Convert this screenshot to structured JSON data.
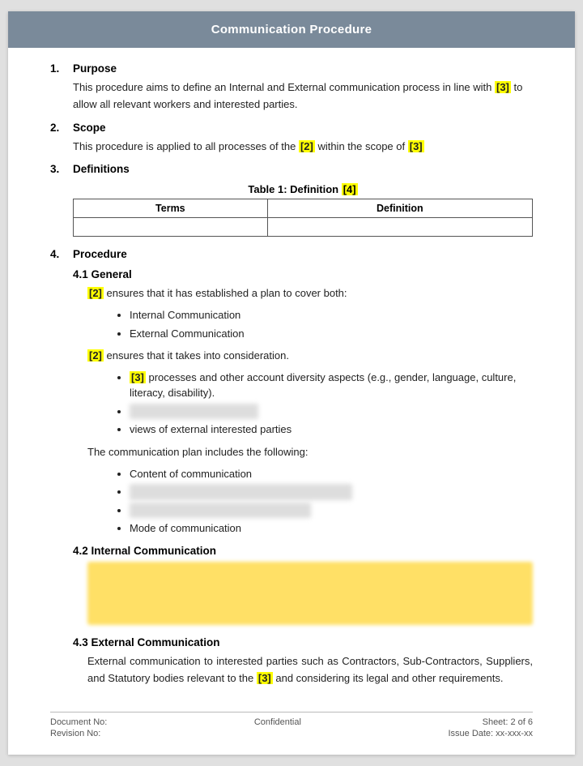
{
  "header": {
    "title": "Communication Procedure"
  },
  "sections": [
    {
      "num": "1.",
      "label": "Purpose",
      "paras": [
        {
          "parts": [
            {
              "type": "text",
              "value": "This procedure aims to define an Internal and External communication process in line with "
            },
            {
              "type": "highlight",
              "value": "[3]"
            },
            {
              "type": "text",
              "value": " to allow all relevant workers and interested parties."
            }
          ]
        }
      ]
    },
    {
      "num": "2.",
      "label": "Scope",
      "paras": [
        {
          "parts": [
            {
              "type": "text",
              "value": "This procedure is applied to all processes of the "
            },
            {
              "type": "highlight",
              "value": "[2]"
            },
            {
              "type": "text",
              "value": " within the scope of "
            },
            {
              "type": "highlight",
              "value": "[3]"
            }
          ]
        }
      ]
    },
    {
      "num": "3.",
      "label": "Definitions",
      "table_caption": "Table 1: Definition ",
      "table_caption_ref": "[4]",
      "table_headers": [
        "Terms",
        "Definition"
      ],
      "table_rows": [
        [
          "",
          ""
        ]
      ]
    },
    {
      "num": "4.",
      "label": "Procedure",
      "subsections": [
        {
          "label": "4.1 General",
          "content": [
            {
              "type": "para_parts",
              "parts": [
                {
                  "type": "highlight",
                  "value": "[2]"
                },
                {
                  "type": "text",
                  "value": " ensures that it has established a plan to cover both:"
                }
              ]
            },
            {
              "type": "bullets",
              "items": [
                "Internal Communication",
                "External Communication"
              ]
            },
            {
              "type": "para_parts",
              "parts": [
                {
                  "type": "highlight",
                  "value": "[2]"
                },
                {
                  "type": "text",
                  "value": " ensures that it takes into consideration."
                }
              ]
            },
            {
              "type": "bullets_mixed",
              "items": [
                {
                  "type": "parts",
                  "parts": [
                    {
                      "type": "highlight",
                      "value": "[3]"
                    },
                    {
                      "type": "text",
                      "value": " processes and other account diversity aspects (e.g., gender, language, culture, literacy, disability)."
                    }
                  ]
                },
                {
                  "type": "blurred",
                  "value": "                                                              "
                },
                {
                  "type": "text",
                  "value": "views of external interested parties"
                }
              ]
            },
            {
              "type": "para_text",
              "value": "The communication plan includes the following:"
            },
            {
              "type": "bullets_mixed2",
              "items": [
                {
                  "type": "text",
                  "value": "Content of communication"
                },
                {
                  "type": "blurred",
                  "value": "                                                                              "
                },
                {
                  "type": "blurred2",
                  "value": "                                                        "
                },
                {
                  "type": "text",
                  "value": "Mode of communication"
                }
              ]
            }
          ]
        },
        {
          "label": "4.2 Internal Communication",
          "content": [
            {
              "type": "yellow_blurred",
              "line1": "                                                                                    ",
              "line2": "                                                                                    ",
              "line3": "                                       "
            }
          ]
        },
        {
          "label": "4.3 External Communication",
          "content": [
            {
              "type": "para_parts",
              "parts": [
                {
                  "type": "text",
                  "value": "External communication to interested parties such as Contractors, Sub-Contractors, Suppliers, and Statutory bodies relevant to the "
                },
                {
                  "type": "highlight",
                  "value": "[3]"
                },
                {
                  "type": "text",
                  "value": " and considering its legal and other requirements."
                }
              ]
            }
          ]
        }
      ]
    }
  ],
  "footer": {
    "doc_no_label": "Document No:",
    "revision_label": "Revision No:",
    "confidential": "Confidential",
    "sheet_label": "Sheet: 2 of 6",
    "issue_label": "Issue Date: xx-xxx-xx"
  }
}
